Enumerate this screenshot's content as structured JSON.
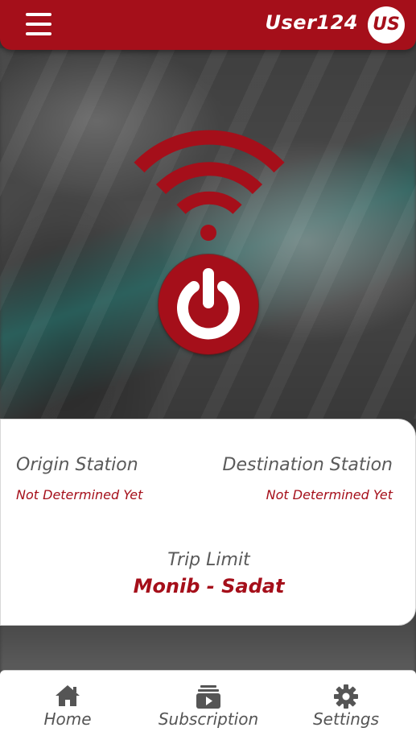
{
  "header": {
    "username": "User124",
    "avatar_initials": "US",
    "accent_color": "#a50f1a"
  },
  "main": {
    "wifi_icon": "wifi-icon",
    "power_icon": "power-icon"
  },
  "card": {
    "origin_label": "Origin Station",
    "origin_value": "Not Determined Yet",
    "destination_label": "Destination Station",
    "destination_value": "Not Determined Yet",
    "trip_limit_label": "Trip Limit",
    "trip_limit_value": "Monib - Sadat"
  },
  "nav": {
    "items": [
      {
        "label": "Home",
        "icon": "home-icon"
      },
      {
        "label": "Subscription",
        "icon": "subscription-icon"
      },
      {
        "label": "Settings",
        "icon": "gear-icon"
      }
    ]
  }
}
